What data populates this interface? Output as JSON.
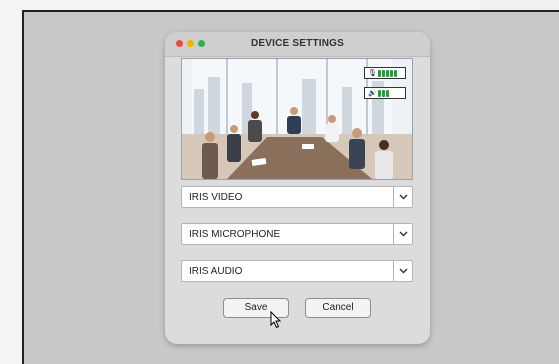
{
  "dialog": {
    "title": "DEVICE SETTINGS"
  },
  "preview": {
    "mic_icon": "microphone-icon",
    "mic_level_bars": 5,
    "speaker_icon": "speaker-icon",
    "speaker_level_bars": 3
  },
  "devices": {
    "video": "IRIS VIDEO",
    "microphone": "IRIS MICROPHONE",
    "audio": "IRIS AUDIO"
  },
  "buttons": {
    "save": "Save",
    "cancel": "Cancel"
  },
  "colors": {
    "window_close": "#e84c3d",
    "window_minimize": "#f0b400",
    "window_maximize": "#2fb344",
    "level_bar": "#1f9e3a"
  }
}
